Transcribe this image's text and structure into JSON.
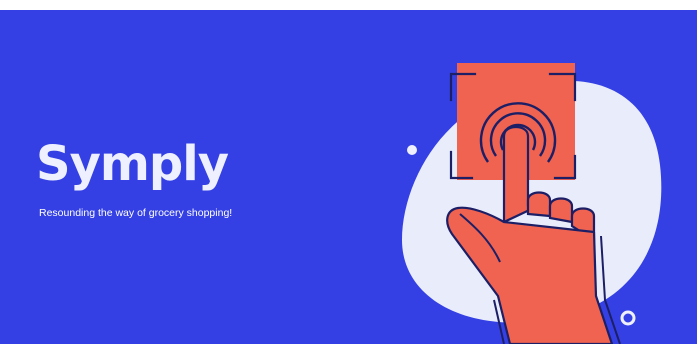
{
  "brand": {
    "name": "Symply",
    "tagline": "Resounding the way of grocery shopping!"
  },
  "colors": {
    "background": "#3440e4",
    "brand_text": "#eef0ff",
    "blob": "#e9edfb",
    "accent": "#ef6350",
    "outline": "#1c1f66"
  },
  "icons": {
    "illustration": "touch-scan-hand-icon",
    "decoration_dot": "dot-icon",
    "decoration_ring": "ring-icon"
  }
}
